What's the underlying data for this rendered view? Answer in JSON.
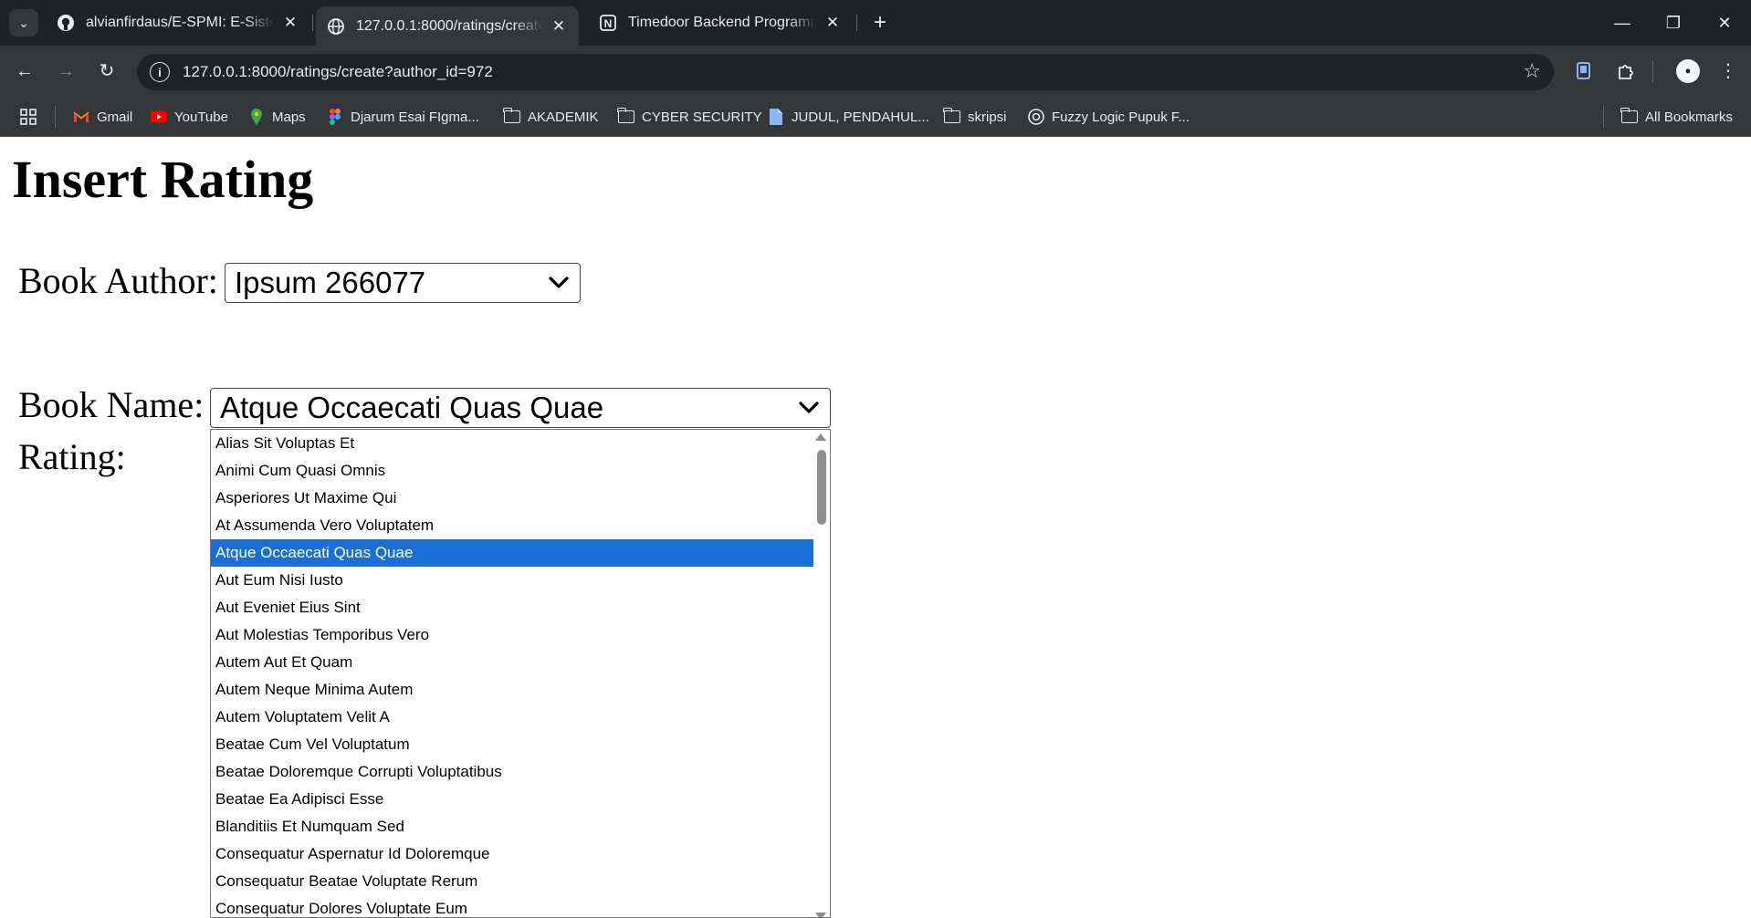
{
  "browser": {
    "tabs": [
      {
        "title": "alvianfirdaus/E-SPMI: E-Sistem Penjaminan Mutu Internal",
        "favicon": "github-icon"
      },
      {
        "title": "127.0.0.1:8000/ratings/create?author_id=972",
        "favicon": "globe-icon"
      },
      {
        "title": "Timedoor Backend Programming",
        "favicon": "notion-icon"
      }
    ],
    "url": "127.0.0.1:8000/ratings/create?author_id=972",
    "bookmarks": [
      {
        "label": "Gmail",
        "icon": "gmail-icon"
      },
      {
        "label": "YouTube",
        "icon": "youtube-icon"
      },
      {
        "label": "Maps",
        "icon": "maps-icon"
      },
      {
        "label": "Djarum Esai FIgma...",
        "icon": "figma-icon"
      },
      {
        "label": "AKADEMIK",
        "icon": "folder-icon"
      },
      {
        "label": "CYBER SECURITY",
        "icon": "folder-icon"
      },
      {
        "label": "JUDUL, PENDAHUL...",
        "icon": "doc-icon"
      },
      {
        "label": "skripsi",
        "icon": "folder-icon"
      },
      {
        "label": "Fuzzy Logic Pupuk F...",
        "icon": "openai-icon"
      }
    ],
    "all_bookmarks": "All Bookmarks",
    "colors": {
      "chrome_dark": "#202124",
      "chrome": "#35363a",
      "selection": "#1a6fd6"
    }
  },
  "page": {
    "heading": "Insert Rating",
    "author_label": "Book Author:",
    "author_selected": "Ipsum 266077",
    "book_label": "Book Name:",
    "book_selected": "Atque Occaecati Quas Quae",
    "rating_label": "Rating:",
    "book_options": [
      "Alias Sit Voluptas Et",
      "Animi Cum Quasi Omnis",
      "Asperiores Ut Maxime Qui",
      "At Assumenda Vero Voluptatem",
      "Atque Occaecati Quas Quae",
      "Aut Eum Nisi Iusto",
      "Aut Eveniet Eius Sint",
      "Aut Molestias Temporibus Vero",
      "Autem Aut Et Quam",
      "Autem Neque Minima Autem",
      "Autem Voluptatem Velit A",
      "Beatae Cum Vel Voluptatum",
      "Beatae Doloremque Corrupti Voluptatibus",
      "Beatae Ea Adipisci Esse",
      "Blanditiis Et Numquam Sed",
      "Consequatur Aspernatur Id Doloremque",
      "Consequatur Beatae Voluptate Rerum",
      "Consequatur Dolores Voluptate Eum"
    ],
    "book_selected_index": 4
  }
}
